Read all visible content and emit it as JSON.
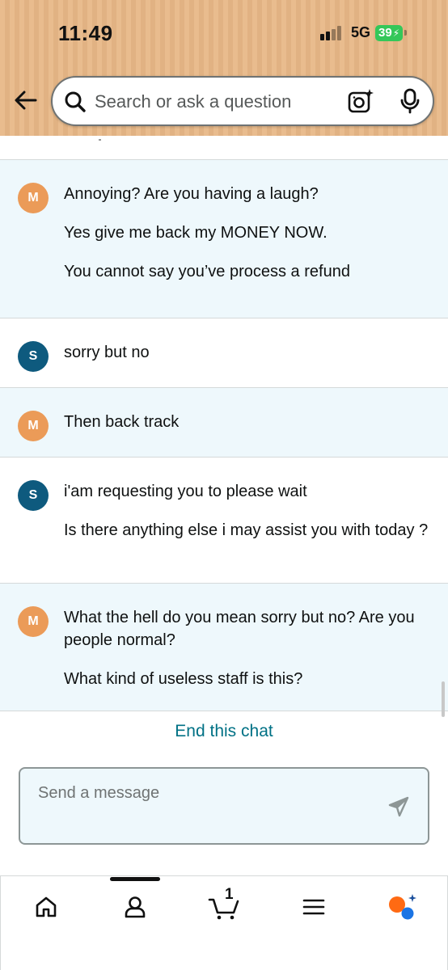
{
  "status_bar": {
    "time": "11:49",
    "network": "5G",
    "battery": "39"
  },
  "search": {
    "placeholder": "Search or ask a question"
  },
  "icons": {
    "back": "back-arrow-icon",
    "search": "search-icon",
    "camera": "camera-lens-icon",
    "mic": "microphone-icon",
    "send": "send-icon",
    "home": "home-icon",
    "account": "person-icon",
    "cart": "cart-icon",
    "menu": "hamburger-menu-icon",
    "rufus": "rufus-assistant-icon"
  },
  "colors": {
    "header_bg": "#e8b887",
    "customer_row_bg": "#eef8fc",
    "agent_row_bg": "#ffffff",
    "customer_avatar": "#eb9b58",
    "agent_avatar": "#0e5a7e",
    "link": "#007185",
    "rufus_orange": "#ff6a13",
    "rufus_blue": "#1b74e4"
  },
  "messages": [
    {
      "sender": "M",
      "lines": [
        "Annoying? Are you having a laugh?",
        "Yes give me back my MONEY NOW.",
        "You cannot say you’ve process a refund"
      ]
    },
    {
      "sender": "S",
      "lines": [
        "sorry but no"
      ]
    },
    {
      "sender": "M",
      "lines": [
        "Then back track"
      ]
    },
    {
      "sender": "S",
      "lines": [
        "i'am requesting you to please wait",
        "Is there anything else i may assist you with today ?"
      ]
    },
    {
      "sender": "M",
      "lines": [
        "What the hell do you mean sorry but no? Are you people normal?",
        "What kind of useless staff is this?"
      ]
    }
  ],
  "end_chat_label": "End this chat",
  "composer": {
    "placeholder": "Send a message"
  },
  "cart_count": "1"
}
